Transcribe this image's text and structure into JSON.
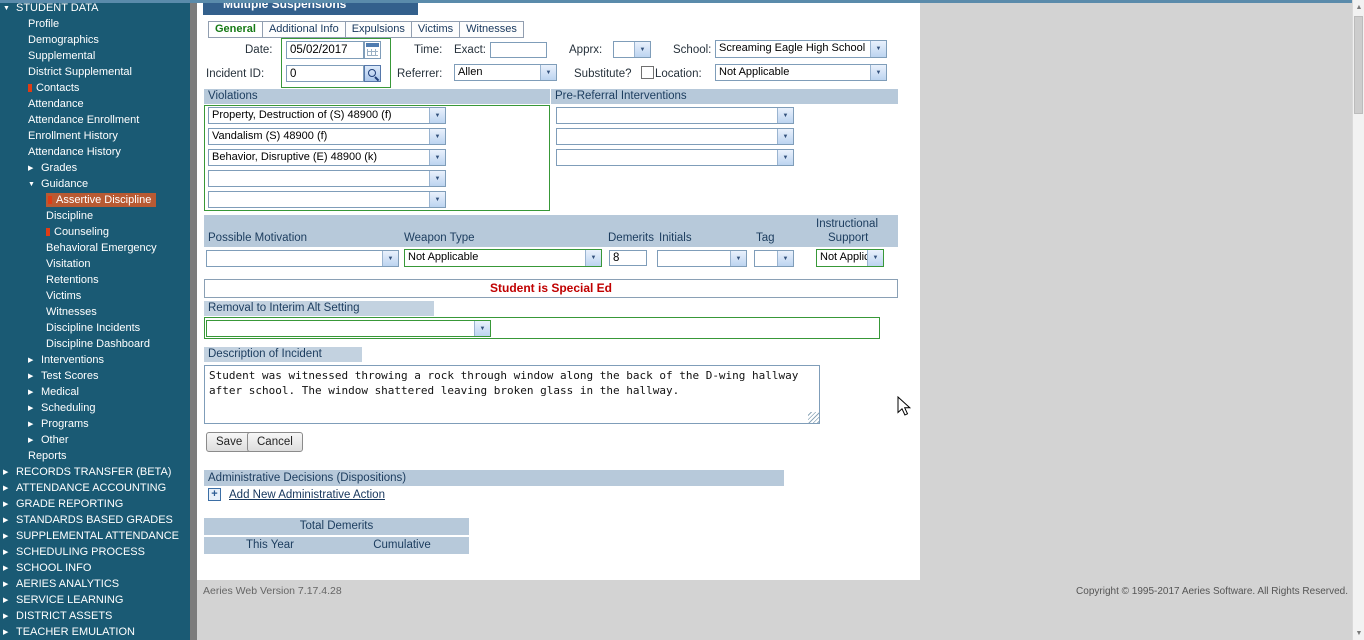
{
  "app": {
    "page_title": "Multiple Suspensions",
    "footer_version": "Aeries Web Version 7.17.4.28",
    "footer_copyright": "Copyright © 1995-2017 Aeries Software. All Rights Reserved."
  },
  "colors": {
    "sidebar_bg": "#1a5a74",
    "selected_item_bg": "#b85a33",
    "header_bar_bg": "#b7c9da",
    "green_border": "#389838",
    "notice_red": "#c00000"
  },
  "icons": {
    "dropdown_arrow": "▼",
    "expand_down": "▼",
    "expand_right": "▶",
    "scroll_up": "▲",
    "scroll_down": "▼",
    "add": "+"
  },
  "sidebar": {
    "items": [
      {
        "label": "STUDENT DATA",
        "level": 0,
        "arrow": "down"
      },
      {
        "label": "Profile",
        "level": 1
      },
      {
        "label": "Demographics",
        "level": 1
      },
      {
        "label": "Supplemental",
        "level": 1
      },
      {
        "label": "District Supplemental",
        "level": 1
      },
      {
        "label": "Contacts",
        "level": 1,
        "flag": true
      },
      {
        "label": "Attendance",
        "level": 1
      },
      {
        "label": "Attendance Enrollment",
        "level": 1
      },
      {
        "label": "Enrollment History",
        "level": 1
      },
      {
        "label": "Attendance History",
        "level": 1
      },
      {
        "label": "Grades",
        "level": 1,
        "arrow": "right"
      },
      {
        "label": "Guidance",
        "level": 1,
        "arrow": "down"
      },
      {
        "label": "Assertive Discipline",
        "level": 2,
        "selected": true,
        "flag": true
      },
      {
        "label": "Discipline",
        "level": 2
      },
      {
        "label": "Counseling",
        "level": 2,
        "flag": true
      },
      {
        "label": "Behavioral Emergency",
        "level": 2
      },
      {
        "label": "Visitation",
        "level": 2
      },
      {
        "label": "Retentions",
        "level": 2
      },
      {
        "label": "Victims",
        "level": 2
      },
      {
        "label": "Witnesses",
        "level": 2
      },
      {
        "label": "Discipline Incidents",
        "level": 2
      },
      {
        "label": "Discipline Dashboard",
        "level": 2
      },
      {
        "label": "Interventions",
        "level": 1,
        "arrow": "right"
      },
      {
        "label": "Test Scores",
        "level": 1,
        "arrow": "right"
      },
      {
        "label": "Medical",
        "level": 1,
        "arrow": "right"
      },
      {
        "label": "Scheduling",
        "level": 1,
        "arrow": "right"
      },
      {
        "label": "Programs",
        "level": 1,
        "arrow": "right"
      },
      {
        "label": "Other",
        "level": 1,
        "arrow": "right"
      },
      {
        "label": "Reports",
        "level": 1
      },
      {
        "label": "RECORDS TRANSFER (BETA)",
        "level": 0,
        "arrow": "right"
      },
      {
        "label": "ATTENDANCE ACCOUNTING",
        "level": 0,
        "arrow": "right"
      },
      {
        "label": "GRADE REPORTING",
        "level": 0,
        "arrow": "right"
      },
      {
        "label": "STANDARDS BASED GRADES",
        "level": 0,
        "arrow": "right"
      },
      {
        "label": "SUPPLEMENTAL ATTENDANCE",
        "level": 0,
        "arrow": "right"
      },
      {
        "label": "SCHEDULING PROCESS",
        "level": 0,
        "arrow": "right"
      },
      {
        "label": "SCHOOL INFO",
        "level": 0,
        "arrow": "right"
      },
      {
        "label": "AERIES ANALYTICS",
        "level": 0,
        "arrow": "right"
      },
      {
        "label": "SERVICE LEARNING",
        "level": 0,
        "arrow": "right"
      },
      {
        "label": "DISTRICT ASSETS",
        "level": 0,
        "arrow": "right"
      },
      {
        "label": "TEACHER EMULATION",
        "level": 0,
        "arrow": "right"
      }
    ]
  },
  "tabs": [
    {
      "label": "General",
      "active": true
    },
    {
      "label": "Additional Info"
    },
    {
      "label": "Expulsions"
    },
    {
      "label": "Victims"
    },
    {
      "label": "Witnesses"
    }
  ],
  "form": {
    "date_label": "Date:",
    "date_value": "05/02/2017",
    "time_label": "Time:",
    "exact_label": "Exact:",
    "exact_value": "",
    "apprx_label": "Apprx:",
    "apprx_value": "",
    "school_label": "School:",
    "school_value": "Screaming Eagle High School",
    "incident_id_label": "Incident ID:",
    "incident_id_value": "0",
    "referrer_label": "Referrer:",
    "referrer_value": "Allen",
    "substitute_label": "Substitute?",
    "substitute_checked": false,
    "location_label": "Location:",
    "location_value": "Not Applicable",
    "violations_header": "Violations",
    "violations": [
      "Property, Destruction of (S) 48900 (f)",
      "Vandalism (S) 48900 (f)",
      "Behavior, Disruptive  (E) 48900 (k)",
      "",
      ""
    ],
    "prereferral_header": "Pre-Referral Interventions",
    "prereferral": [
      "",
      "",
      ""
    ],
    "motivation_label": "Possible Motivation",
    "motivation_value": "",
    "weapon_label": "Weapon Type",
    "weapon_value": "Not Applicable",
    "demerits_label": "Demerits",
    "demerits_value": "8",
    "initials_label": "Initials",
    "initials_value": "",
    "tag_label": "Tag",
    "tag_value": "",
    "instructional_label_line1": "Instructional",
    "instructional_label_line2": "Support",
    "instructional_value": "Not Applicable",
    "special_ed_notice": "Student is Special Ed",
    "removal_label": "Removal to Interim Alt Setting",
    "removal_value": "",
    "description_label": "Description of Incident",
    "description_value": "Student was witnessed throwing a rock through window along the back of the D-wing hallway after school. The window shattered leaving broken glass in the hallway.",
    "save_label": "Save",
    "cancel_label": "Cancel",
    "admin_header": "Administrative Decisions (Dispositions)",
    "add_admin_link": "Add New Administrative Action",
    "total_demerits_header": "Total Demerits",
    "this_year_label": "This Year",
    "cumulative_label": "Cumulative"
  }
}
